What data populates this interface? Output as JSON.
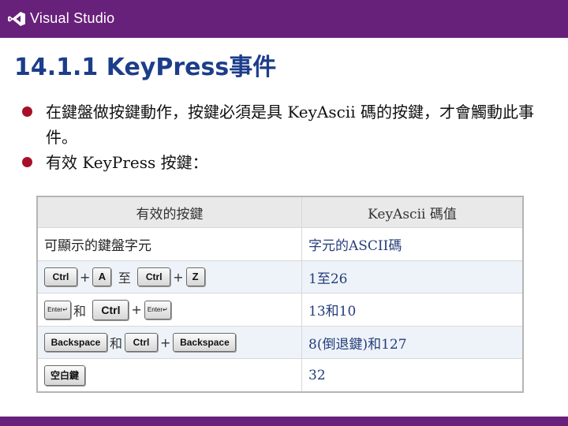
{
  "header": {
    "brand": "Visual Studio",
    "logo_icon": "visual-studio-logo-icon",
    "color": "#68217a"
  },
  "title": "14.1.1  KeyPress事件",
  "bullets": [
    "在鍵盤做按鍵動作，按鍵必須是具 KeyAscii 碼的按鍵，才會觸動此事件。",
    "有效 KeyPress 按鍵："
  ],
  "table": {
    "headers": [
      "有效的按鍵",
      "KeyAscii 碼值"
    ],
    "rows": [
      {
        "col2": "字元的ASCII碼",
        "col1_text": "可顯示的鍵盤字元"
      },
      {
        "col2": "1至26",
        "keys": {
          "ctrl": "Ctrl",
          "plus": "+",
          "a": "A",
          "to": "至",
          "z": "Z"
        }
      },
      {
        "col2": "13和10",
        "keys": {
          "enter": "Enter↵",
          "and": "和",
          "ctrl": "Ctrl",
          "plus": "+"
        }
      },
      {
        "col2": "8(倒退鍵)和127",
        "keys": {
          "backspace": "Backspace",
          "and": "和",
          "ctrl": "Ctrl",
          "plus": "+"
        }
      },
      {
        "col2": "32",
        "keys": {
          "space": "空白鍵"
        }
      }
    ]
  }
}
